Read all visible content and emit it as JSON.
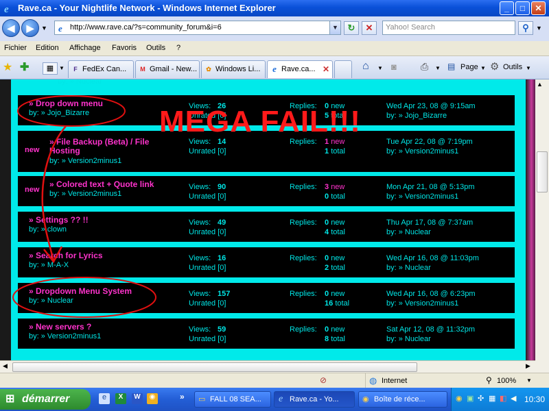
{
  "window": {
    "title": "Rave.ca - Your Nightlife Network - Windows Internet Explorer",
    "minimize_glyph": "_",
    "maximize_glyph": "□",
    "close_glyph": "✕"
  },
  "address": {
    "url": "http://www.rave.ca/?s=community_forum&i=6",
    "search_placeholder": "Yahoo! Search"
  },
  "menu": [
    "Fichier",
    "Edition",
    "Affichage",
    "Favoris",
    "Outils",
    "?"
  ],
  "tabs": [
    {
      "label": "FedEx Can...",
      "icon": "fedex-icon"
    },
    {
      "label": "Gmail - New...",
      "icon": "gmail-icon"
    },
    {
      "label": "Windows Li...",
      "icon": "windows-live-icon"
    },
    {
      "label": "Rave.ca...",
      "icon": "ie-icon",
      "active": true
    }
  ],
  "toolbar": {
    "page_label": "Page",
    "tools_label": "Outils"
  },
  "forum": {
    "partial_top": "by: » Nuclear",
    "views_label": "Views:",
    "unrated_prefix": "Unrated",
    "replies_label": "Replies:",
    "new_label": "new",
    "total_label": "total",
    "by_label": "by:",
    "rows": [
      {
        "title": "» Drop down menu",
        "author": "» Jojo_Bizarre",
        "views": "26",
        "unrated": "[0]",
        "new": "0",
        "total": "5",
        "last_date": "Wed Apr 23, 08 @ 9:15am",
        "last_by": "» Jojo_Bizarre",
        "is_new": false,
        "highlight_new": false
      },
      {
        "title": "» File Backup (Beta) / File Hosting",
        "author": "» Version2minus1",
        "views": "14",
        "unrated": "[0]",
        "new": "1",
        "total": "1",
        "last_date": "Tue Apr 22, 08 @ 7:19pm",
        "last_by": "» Version2minus1",
        "is_new": true,
        "highlight_new": true
      },
      {
        "title": "» Colored text + Quote link",
        "author": "» Version2minus1",
        "views": "90",
        "unrated": "[0]",
        "new": "3",
        "total": "0",
        "last_date": "Mon Apr 21, 08 @ 5:13pm",
        "last_by": "» Version2minus1",
        "is_new": true,
        "highlight_new": true
      },
      {
        "title": "» Settings ?? !!",
        "author": "» clown",
        "views": "49",
        "unrated": "[0]",
        "new": "0",
        "total": "4",
        "last_date": "Thu Apr 17, 08 @ 7:37am",
        "last_by": "» Nuclear",
        "is_new": false,
        "highlight_new": false
      },
      {
        "title": "» Search for Lyrics",
        "author": "» M-A-X",
        "views": "16",
        "unrated": "[0]",
        "new": "0",
        "total": "2",
        "last_date": "Wed Apr 16, 08 @ 11:03pm",
        "last_by": "» Nuclear",
        "is_new": false,
        "highlight_new": false
      },
      {
        "title": "» Dropdown Menu System",
        "author": "» Nuclear",
        "views": "157",
        "unrated": "[0]",
        "new": "0",
        "total": "16",
        "last_date": "Wed Apr 16, 08 @ 6:23pm",
        "last_by": "» Version2minus1",
        "is_new": false,
        "highlight_new": false
      },
      {
        "title": "» New servers ?",
        "author": "» Version2minus1",
        "views": "59",
        "unrated": "[0]",
        "new": "0",
        "total": "8",
        "last_date": "Sat Apr 12, 08 @ 11:32pm",
        "last_by": "» Nuclear",
        "is_new": false,
        "highlight_new": false
      }
    ]
  },
  "annotation": {
    "text": "MEGA FAIL!!!",
    "color": "#ff1a1a"
  },
  "status": {
    "zone": "Internet",
    "zoom": "100%"
  },
  "taskbar": {
    "start_label": "démarrer",
    "items": [
      {
        "label": "FALL 08 SEA...",
        "icon": "folder-icon"
      },
      {
        "label": "Rave.ca - Yo...",
        "icon": "ie-icon",
        "active": true
      },
      {
        "label": "Boîte de réce...",
        "icon": "outlook-icon"
      }
    ],
    "clock": "10:30"
  },
  "colors": {
    "cyan": "#00eaea",
    "pink": "#ff33cc",
    "text_cyan": "#00e6e6",
    "black": "#000000"
  }
}
